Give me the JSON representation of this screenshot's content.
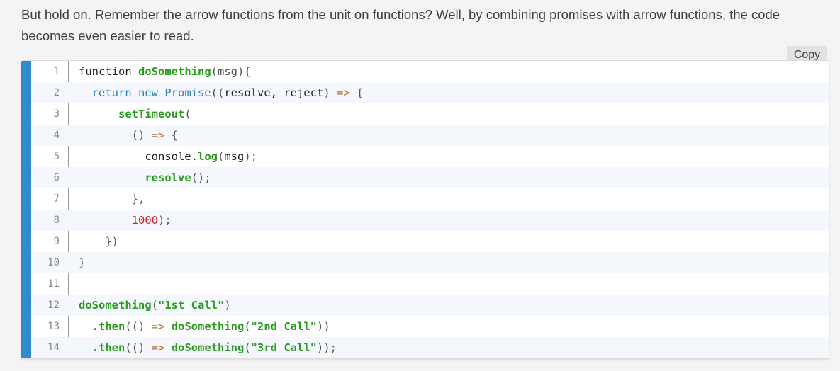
{
  "intro_text": "But hold on. Remember the arrow functions from the unit on functions? Well, by combining promises with arrow functions, the code becomes even easier to read.",
  "copy_button": "Copy",
  "accent_color": "#2f8ccc",
  "code": {
    "language": "javascript",
    "lines": [
      {
        "n": "1",
        "tokens": [
          [
            "plain",
            "function "
          ],
          [
            "fn",
            "doSomething"
          ],
          [
            "pn",
            "(msg){"
          ]
        ]
      },
      {
        "n": "2",
        "tokens": [
          [
            "plain",
            "  "
          ],
          [
            "kw",
            "return new Promise"
          ],
          [
            "pn",
            "(("
          ],
          [
            "plain",
            "resolve, reject"
          ],
          [
            "pn",
            ") "
          ],
          [
            "op",
            "=>"
          ],
          [
            "pn",
            " {"
          ]
        ]
      },
      {
        "n": "3",
        "tokens": [
          [
            "plain",
            "      "
          ],
          [
            "fn",
            "setTimeout"
          ],
          [
            "pn",
            "("
          ]
        ]
      },
      {
        "n": "4",
        "tokens": [
          [
            "plain",
            "        "
          ],
          [
            "pn",
            "() "
          ],
          [
            "op",
            "=>"
          ],
          [
            "pn",
            " {"
          ]
        ]
      },
      {
        "n": "5",
        "tokens": [
          [
            "plain",
            "          console."
          ],
          [
            "fn",
            "log"
          ],
          [
            "pn",
            "("
          ],
          [
            "plain",
            "msg"
          ],
          [
            "pn",
            ");"
          ]
        ]
      },
      {
        "n": "6",
        "tokens": [
          [
            "plain",
            "          "
          ],
          [
            "fn",
            "resolve"
          ],
          [
            "pn",
            "();"
          ]
        ]
      },
      {
        "n": "7",
        "tokens": [
          [
            "plain",
            "        "
          ],
          [
            "pn",
            "},"
          ]
        ]
      },
      {
        "n": "8",
        "tokens": [
          [
            "plain",
            "        "
          ],
          [
            "num",
            "1000"
          ],
          [
            "pn",
            ");"
          ]
        ]
      },
      {
        "n": "9",
        "tokens": [
          [
            "plain",
            "    "
          ],
          [
            "pn",
            "})"
          ]
        ]
      },
      {
        "n": "10",
        "tokens": [
          [
            "pn",
            "}"
          ]
        ]
      },
      {
        "n": "11",
        "tokens": []
      },
      {
        "n": "12",
        "tokens": [
          [
            "fn",
            "doSomething"
          ],
          [
            "pn",
            "("
          ],
          [
            "str",
            "\"1st Call\""
          ],
          [
            "pn",
            ")"
          ]
        ]
      },
      {
        "n": "13",
        "tokens": [
          [
            "plain",
            "  "
          ],
          [
            "fn",
            ".then"
          ],
          [
            "pn",
            "(() "
          ],
          [
            "op",
            "=>"
          ],
          [
            "plain",
            " "
          ],
          [
            "fn",
            "doSomething"
          ],
          [
            "pn",
            "("
          ],
          [
            "str",
            "\"2nd Call\""
          ],
          [
            "pn",
            "))"
          ]
        ]
      },
      {
        "n": "14",
        "tokens": [
          [
            "plain",
            "  "
          ],
          [
            "fn",
            ".then"
          ],
          [
            "pn",
            "(() "
          ],
          [
            "op",
            "=>"
          ],
          [
            "plain",
            " "
          ],
          [
            "fn",
            "doSomething"
          ],
          [
            "pn",
            "("
          ],
          [
            "str",
            "\"3rd Call\""
          ],
          [
            "pn",
            "));"
          ]
        ]
      }
    ]
  }
}
